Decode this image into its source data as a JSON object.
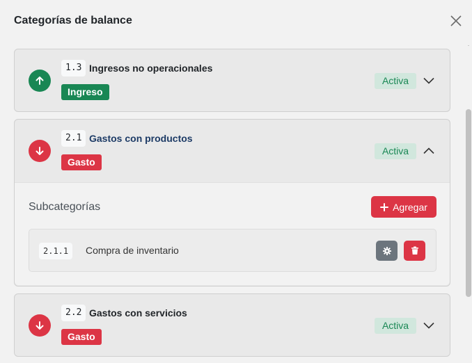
{
  "modal": {
    "title": "Categorías de balance"
  },
  "categories": [
    {
      "code": "1.3",
      "name": "Ingresos no operacionales",
      "type_label": "Ingreso",
      "status": "Activa",
      "direction_icon": "arrow-up-icon",
      "expanded": false
    },
    {
      "code": "2.1",
      "name": "Gastos con productos",
      "type_label": "Gasto",
      "status": "Activa",
      "direction_icon": "arrow-down-icon",
      "expanded": true,
      "subcategories_title": "Subcategorías",
      "add_label": "Agregar",
      "subcategories": [
        {
          "code": "2.1.1",
          "name": "Compra de inventario"
        }
      ]
    },
    {
      "code": "2.2",
      "name": "Gastos con servicios",
      "type_label": "Gasto",
      "status": "Activa",
      "direction_icon": "arrow-down-icon",
      "expanded": false
    }
  ],
  "colors": {
    "income": "#198754",
    "expense": "#dc3545",
    "status_bg": "#d1e7dd",
    "settings_button": "#6c757d"
  }
}
